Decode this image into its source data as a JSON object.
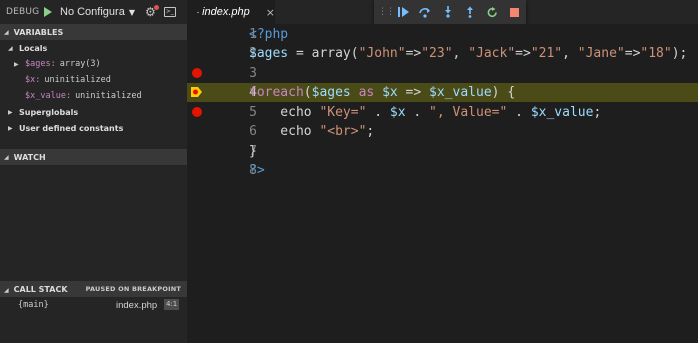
{
  "debug": {
    "title": "DEBUG",
    "config_value": "No Configura",
    "colors": {
      "play": "#89d185",
      "breakpoint": "#e51400",
      "current_line": "#4b4b18"
    }
  },
  "variables": {
    "header": "VARIABLES",
    "locals_label": "Locals",
    "items": [
      {
        "name": "$ages:",
        "value": "array(3)"
      },
      {
        "name": "$x:",
        "value": "uninitialized"
      },
      {
        "name": "$x_value:",
        "value": "uninitialized"
      }
    ],
    "superglobals_label": "Superglobals",
    "user_constants_label": "User defined constants"
  },
  "watch": {
    "header": "WATCH"
  },
  "callstack": {
    "header": "CALL STACK",
    "status": "PAUSED ON BREAKPOINT",
    "frames": [
      {
        "name": "{main}",
        "file": "index.php",
        "pos": "4:1"
      }
    ]
  },
  "tab": {
    "label": "index.php",
    "icon": "php-file-icon",
    "close": "×"
  },
  "toolbar": {
    "grip": "⋮⋮",
    "icons": [
      "continue-icon",
      "step-over-icon",
      "step-into-icon",
      "step-out-icon",
      "restart-icon",
      "stop-icon"
    ]
  },
  "editor": {
    "line_numbers": [
      "1",
      "2",
      "3",
      "4",
      "5",
      "6",
      "7",
      "8"
    ],
    "breakpoint_lines": [
      3,
      4,
      5
    ],
    "current_line": 4,
    "lines": [
      [
        {
          "t": "<?php",
          "c": "tag"
        }
      ],
      [
        {
          "t": "$ages",
          "c": "var"
        },
        {
          "t": " = ",
          "c": "op"
        },
        {
          "t": "array",
          "c": "fn"
        },
        {
          "t": "(",
          "c": "op"
        },
        {
          "t": "\"John\"",
          "c": "str"
        },
        {
          "t": "=>",
          "c": "op"
        },
        {
          "t": "\"23\"",
          "c": "str"
        },
        {
          "t": ", ",
          "c": "op"
        },
        {
          "t": "\"Jack\"",
          "c": "str"
        },
        {
          "t": "=>",
          "c": "op"
        },
        {
          "t": "\"21\"",
          "c": "str"
        },
        {
          "t": ", ",
          "c": "op"
        },
        {
          "t": "\"Jane\"",
          "c": "str"
        },
        {
          "t": "=>",
          "c": "op"
        },
        {
          "t": "\"18\"",
          "c": "str"
        },
        {
          "t": ");",
          "c": "op"
        }
      ],
      [],
      [
        {
          "t": "foreach",
          "c": "kw"
        },
        {
          "t": "(",
          "c": "op"
        },
        {
          "t": "$ages",
          "c": "var"
        },
        {
          "t": " as ",
          "c": "kw"
        },
        {
          "t": "$x",
          "c": "var"
        },
        {
          "t": " => ",
          "c": "op"
        },
        {
          "t": "$x_value",
          "c": "var"
        },
        {
          "t": ") {",
          "c": "op"
        }
      ],
      [
        {
          "t": "    echo ",
          "c": "fn"
        },
        {
          "t": "\"Key=\"",
          "c": "str"
        },
        {
          "t": " . ",
          "c": "op"
        },
        {
          "t": "$x",
          "c": "var"
        },
        {
          "t": " . ",
          "c": "op"
        },
        {
          "t": "\", Value=\"",
          "c": "str"
        },
        {
          "t": " . ",
          "c": "op"
        },
        {
          "t": "$x_value",
          "c": "var"
        },
        {
          "t": ";",
          "c": "op"
        }
      ],
      [
        {
          "t": "    echo ",
          "c": "fn"
        },
        {
          "t": "\"<br>\"",
          "c": "str"
        },
        {
          "t": ";",
          "c": "op"
        }
      ],
      [
        {
          "t": "}",
          "c": "op"
        }
      ],
      [
        {
          "t": "?>",
          "c": "tag"
        }
      ]
    ]
  }
}
